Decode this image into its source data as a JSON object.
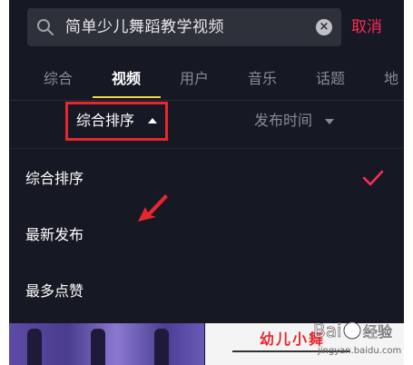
{
  "search": {
    "query": "简单少儿舞蹈教学视频",
    "cancel_label": "取消"
  },
  "tabs": [
    {
      "label": "综合",
      "active": false
    },
    {
      "label": "视频",
      "active": true
    },
    {
      "label": "用户",
      "active": false
    },
    {
      "label": "音乐",
      "active": false
    },
    {
      "label": "话题",
      "active": false
    },
    {
      "label": "地",
      "active": false
    }
  ],
  "sort_bar": {
    "sort_label": "综合排序",
    "time_label": "发布时间"
  },
  "sort_menu": {
    "options": [
      {
        "label": "综合排序",
        "selected": true
      },
      {
        "label": "最新发布",
        "selected": false
      },
      {
        "label": "最多点赞",
        "selected": false
      }
    ]
  },
  "results": {
    "thumb2_title": "幼儿小舞"
  },
  "watermark": {
    "logo_text": "Bai度 经验",
    "site": "jingyan.baidu.com"
  },
  "colors": {
    "background": "#161823",
    "accent_red": "#fe2c55",
    "tab_underline": "#f2d34a",
    "highlight_box": "#e8262d"
  }
}
